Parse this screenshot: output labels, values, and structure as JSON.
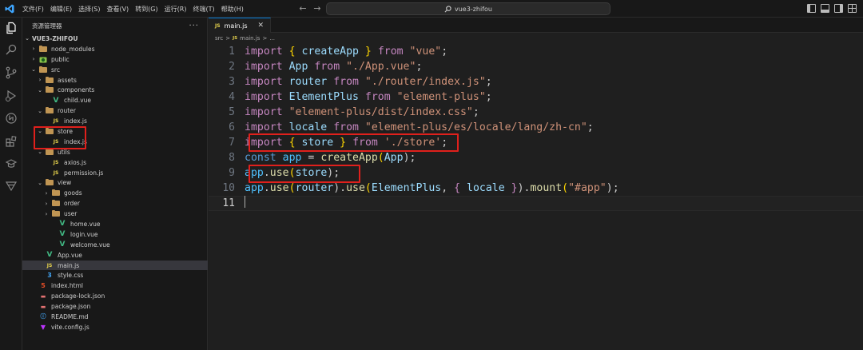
{
  "menu": [
    "文件(F)",
    "编辑(E)",
    "选择(S)",
    "查看(V)",
    "转到(G)",
    "运行(R)",
    "终端(T)",
    "帮助(H)"
  ],
  "command_center": {
    "label": "vue3-zhifou"
  },
  "sidebar": {
    "title": "资源管理器",
    "more_label": "···",
    "root": "VUE3-ZHIFOU",
    "items": [
      {
        "label": "node_modules"
      },
      {
        "label": "public"
      },
      {
        "label": "src"
      },
      {
        "label": "assets"
      },
      {
        "label": "components"
      },
      {
        "label": "child.vue"
      },
      {
        "label": "router"
      },
      {
        "label": "index.js"
      },
      {
        "label": "store"
      },
      {
        "label": "index.js"
      },
      {
        "label": "utils"
      },
      {
        "label": "axios.js"
      },
      {
        "label": "permission.js"
      },
      {
        "label": "view"
      },
      {
        "label": "goods"
      },
      {
        "label": "order"
      },
      {
        "label": "user"
      },
      {
        "label": "home.vue"
      },
      {
        "label": "login.vue"
      },
      {
        "label": "welcome.vue"
      },
      {
        "label": "App.vue"
      },
      {
        "label": "main.js"
      },
      {
        "label": "style.css"
      },
      {
        "label": "index.html"
      },
      {
        "label": "package-lock.json"
      },
      {
        "label": "package.json"
      },
      {
        "label": "README.md"
      },
      {
        "label": "vite.config.js"
      }
    ]
  },
  "editor": {
    "tab": {
      "label": "main.js",
      "badge": "JS",
      "close": "✕"
    },
    "breadcrumb": {
      "folder": "src",
      "sep": ">",
      "file": "main.js",
      "sep2": ">",
      "more": "..."
    },
    "line_numbers": [
      "1",
      "2",
      "3",
      "4",
      "5",
      "6",
      "7",
      "8",
      "9",
      "10",
      "11"
    ],
    "code": {
      "l1": [
        "import",
        " ",
        "{",
        " ",
        "createApp",
        " ",
        "}",
        " ",
        "from",
        " ",
        "\"vue\"",
        ";"
      ],
      "l2": [
        "import",
        " ",
        "App",
        " ",
        "from",
        " ",
        "\"./App.vue\"",
        ";"
      ],
      "l3": [
        "import",
        " ",
        "router",
        " ",
        "from",
        " ",
        "\"./router/index.js\"",
        ";"
      ],
      "l4": [
        "import",
        " ",
        "ElementPlus",
        " ",
        "from",
        " ",
        "\"element-plus\"",
        ";"
      ],
      "l5": [
        "import",
        " ",
        "\"element-plus/dist/index.css\"",
        ";"
      ],
      "l6": [
        "import",
        " ",
        "locale",
        " ",
        "from",
        " ",
        "\"element-plus/es/locale/lang/zh-cn\"",
        ";"
      ],
      "l7": [
        "import",
        " ",
        "{",
        " ",
        "store",
        " ",
        "}",
        " ",
        "from",
        " ",
        "'./store'",
        ";"
      ],
      "l8": [
        "const",
        " ",
        "app",
        " = ",
        "createApp",
        "(",
        "App",
        ");"
      ],
      "l9": [
        "app",
        ".",
        "use",
        "(",
        "store",
        ");"
      ],
      "l10": [
        "app",
        ".",
        "use",
        "(",
        "router",
        ").",
        "use",
        "(",
        "ElementPlus",
        ", ",
        "{",
        " ",
        "locale",
        " ",
        "}",
        ").",
        "mount",
        "(",
        "\"#app\"",
        ");"
      ]
    }
  },
  "colors": {
    "highlight_box": "#e0201c",
    "accent": "#0078d4"
  }
}
